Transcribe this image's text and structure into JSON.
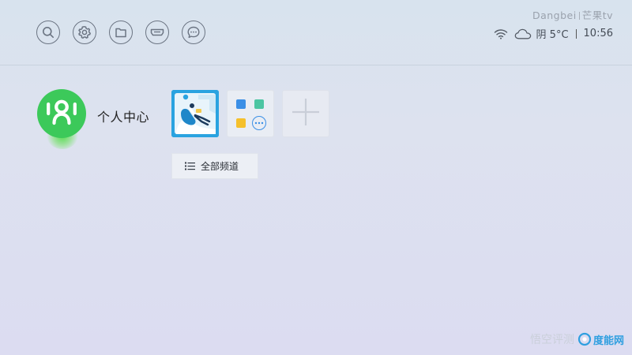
{
  "header": {
    "brand_primary": "Dangbei",
    "brand_secondary": "芒果tv",
    "toolbar": [
      {
        "name": "search-button",
        "icon": "search-icon"
      },
      {
        "name": "settings-button",
        "icon": "gear-icon"
      },
      {
        "name": "files-button",
        "icon": "folder-icon"
      },
      {
        "name": "hdmi-button",
        "icon": "hdmi-icon"
      },
      {
        "name": "more-button",
        "icon": "chat-more-icon"
      }
    ],
    "status": {
      "wifi_icon": "wifi-icon",
      "weather_icon": "cloud-icon",
      "weather": "阴 5°C",
      "time": "10:56"
    }
  },
  "user": {
    "avatar_icon": "user-avatar-icon",
    "label": "个人中心"
  },
  "apps": [
    {
      "name": "featured-app-tile",
      "icon": "person-in-chair-illustration"
    },
    {
      "name": "app-group-tile",
      "icon": "app-folder-icon"
    },
    {
      "name": "add-app-tile",
      "icon": "plus-icon"
    }
  ],
  "all_channels": {
    "label": "全部频道",
    "icon": "list-icon"
  },
  "watermark": {
    "gray_text": "悟空评测",
    "blue_text": "度能网"
  },
  "colors": {
    "accent_green": "#3cc95a",
    "tile_blue": "#2aa3e0",
    "watermark_blue": "#2f9fe0"
  }
}
